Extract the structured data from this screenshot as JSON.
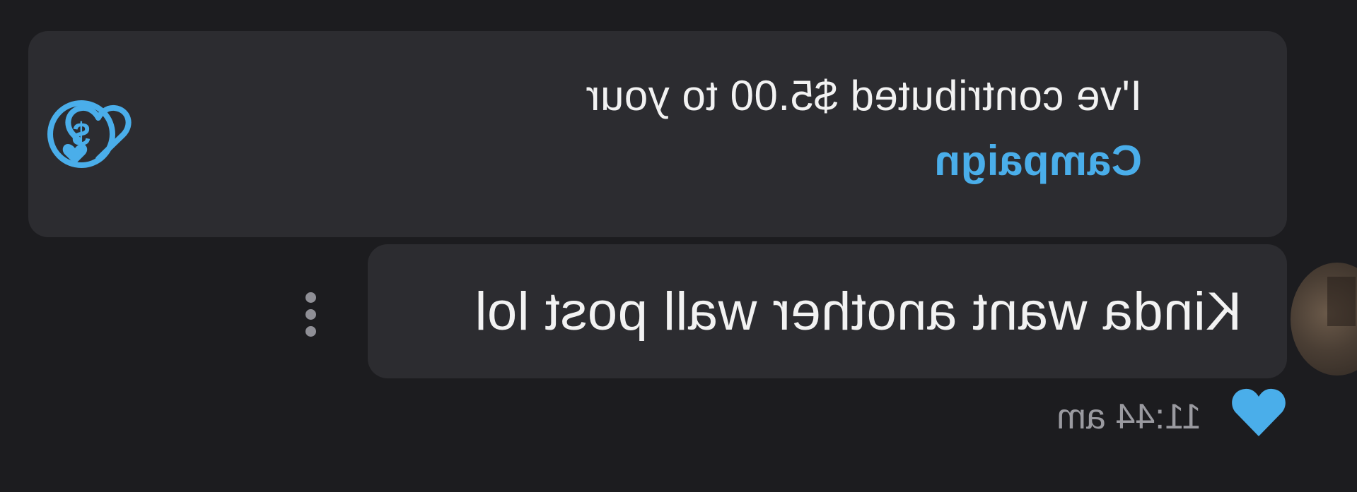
{
  "contribution": {
    "text": "I've contributed $5.00 to your",
    "link_label": "Campaign",
    "icon": "dollar-circle-icon",
    "reaction_icon": "heart-outline-icon"
  },
  "message": {
    "text": "Kinda want another wall post lol",
    "more_icon": "kebab-menu-icon"
  },
  "footer": {
    "timestamp": "11:44 am",
    "like_icon": "heart-filled-icon"
  },
  "colors": {
    "background": "#1c1c1f",
    "bubble": "#2c2c30",
    "accent": "#4aaeea",
    "text": "#f2f2f2",
    "muted": "#9a9aa0"
  }
}
